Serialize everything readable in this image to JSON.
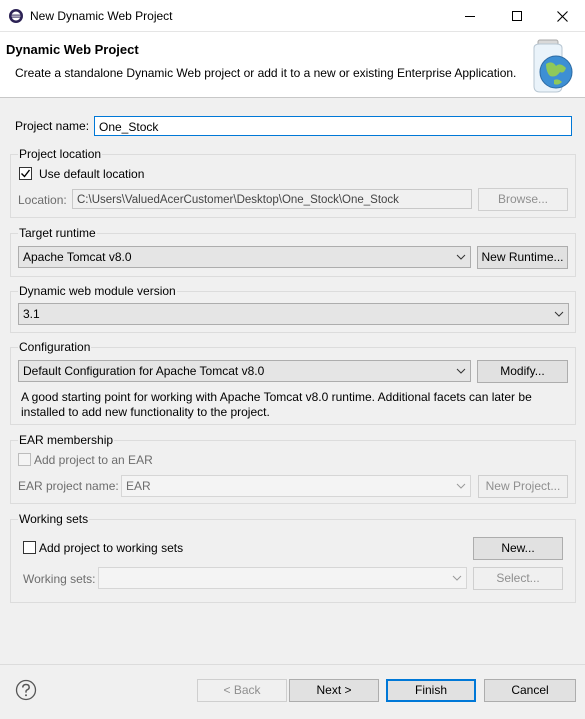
{
  "window": {
    "title": "New Dynamic Web Project"
  },
  "banner": {
    "title": "Dynamic Web Project",
    "description": "Create a standalone Dynamic Web project or add it to a new or existing Enterprise Application."
  },
  "project_name": {
    "label": "Project name:",
    "value": "One_Stock"
  },
  "project_location": {
    "group_title": "Project location",
    "use_default_label": "Use default location",
    "use_default_checked": true,
    "location_label": "Location:",
    "location_value": "C:\\Users\\ValuedAcerCustomer\\Desktop\\One_Stock\\One_Stock",
    "browse_label": "Browse..."
  },
  "target_runtime": {
    "group_title": "Target runtime",
    "selected": "Apache Tomcat v8.0",
    "new_runtime_label": "New Runtime..."
  },
  "module_version": {
    "group_title": "Dynamic web module version",
    "selected": "3.1"
  },
  "configuration": {
    "group_title": "Configuration",
    "selected": "Default Configuration for Apache Tomcat v8.0",
    "modify_label": "Modify...",
    "description_line1": "A good starting point for working with Apache Tomcat v8.0 runtime. Additional facets can later be",
    "description_line2": "installed to add new functionality to the project."
  },
  "ear": {
    "group_title": "EAR membership",
    "add_label": "Add project to an EAR",
    "add_checked": false,
    "name_label": "EAR project name:",
    "name_value": "EAR",
    "new_project_label": "New Project..."
  },
  "working_sets": {
    "group_title": "Working sets",
    "add_label": "Add project to working sets",
    "add_checked": false,
    "new_label": "New...",
    "sets_label": "Working sets:",
    "sets_value": "",
    "select_label": "Select..."
  },
  "footer": {
    "back_label": "< Back",
    "next_label": "Next >",
    "finish_label": "Finish",
    "cancel_label": "Cancel"
  },
  "colors": {
    "accent": "#0078d7",
    "banner_bg": "#ffffff",
    "dialog_bg": "#f0f0f0"
  }
}
